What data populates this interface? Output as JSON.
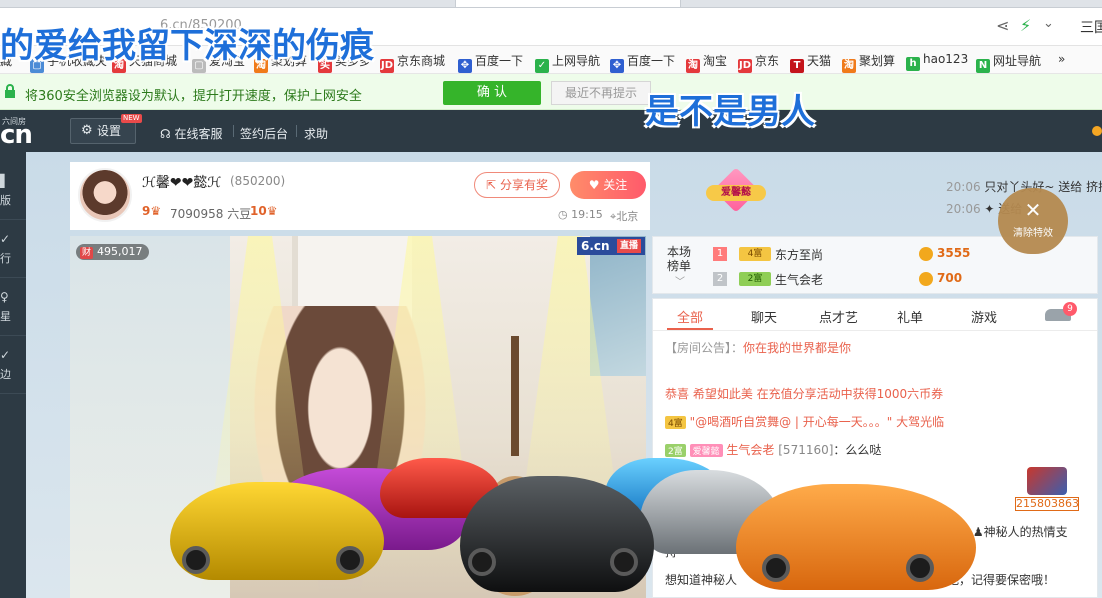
{
  "browser": {
    "url_hint": "6.cn/850200",
    "menu_label": "三国"
  },
  "bookmarks": [
    {
      "label": "藏",
      "icon": "star-icon",
      "color": "#888888"
    },
    {
      "label": "手机收藏夹",
      "icon": "doc-icon",
      "color": "#4b8bd6"
    },
    {
      "label": "天猫商城",
      "icon": "taobao-icon",
      "color": "#e4393c"
    },
    {
      "label": "爱淘宝",
      "icon": "doc-icon",
      "color": "#888888"
    },
    {
      "label": "聚划算",
      "icon": "taobao-icon",
      "color": "#f07a1a"
    },
    {
      "label": "美多多",
      "icon": "buy-icon",
      "color": "#e4393c"
    },
    {
      "label": "京东商城",
      "icon": "jd-icon",
      "color": "#e4393c"
    },
    {
      "label": "百度一下",
      "icon": "baidu-icon",
      "color": "#2f5fd0"
    },
    {
      "label": "上网导航",
      "icon": "hao-icon",
      "color": "#2bb24c"
    },
    {
      "label": "百度一下",
      "icon": "baidu-icon",
      "color": "#2f5fd0"
    },
    {
      "label": "淘宝",
      "icon": "taobao-icon",
      "color": "#e4393c"
    },
    {
      "label": "京东",
      "icon": "jd-icon",
      "color": "#e4393c"
    },
    {
      "label": "天猫",
      "icon": "tmall-icon",
      "color": "#c4141b"
    },
    {
      "label": "聚划算",
      "icon": "taobao-icon",
      "color": "#f07a1a"
    },
    {
      "label": "hao123",
      "icon": "hao123-icon",
      "color": "#2bb24c"
    },
    {
      "label": "网址导航",
      "icon": "nav-icon",
      "color": "#2bb24c"
    },
    {
      "label": "»",
      "icon": "",
      "color": "#666666"
    }
  ],
  "notify": {
    "message": "将360安全浏览器设为默认，提升打开速度，保护上网安全",
    "confirm": "确 认",
    "dismiss": "最近不再提示"
  },
  "nav": {
    "logo_small": "六间房",
    "logo_big": "cn",
    "settings": "设置",
    "new_badge": "NEW",
    "service": "在线客服",
    "backend": "签约后台",
    "help": "求助"
  },
  "sidebar": [
    {
      "icon": "▌",
      "label": "版"
    },
    {
      "icon": "✓",
      "label": "行"
    },
    {
      "icon": "♀",
      "label": "星"
    },
    {
      "icon": "✓",
      "label": "边"
    }
  ],
  "host": {
    "name": "ℋ馨❤❤懿ℋ",
    "room_id": "(850200)",
    "wealth_level": "9",
    "beans": "7090958 六豆",
    "star_level": "10",
    "share": "分享有奖",
    "follow": "关注",
    "time": "19:15",
    "city": "北京"
  },
  "fan_badge": "爱馨懿",
  "ticker": [
    {
      "time": "20:06",
      "text": "只对丫头好~ 送给 挤挤"
    },
    {
      "time": "20:06",
      "text": "✦ 送给 し"
    }
  ],
  "clear_effects": "清除特效",
  "video": {
    "viewer_tag": "财",
    "viewers": "495,017",
    "brand": "6.cn",
    "live": "直播"
  },
  "rank": {
    "label": "本场 榜单",
    "rows": [
      {
        "num": "1",
        "badge": "4富",
        "name": "东方至尚",
        "value": "3555"
      },
      {
        "num": "2",
        "badge": "2富",
        "name": "生气会老",
        "value": "700"
      }
    ]
  },
  "chat": {
    "tabs": [
      "全部",
      "聊天",
      "点才艺",
      "礼单",
      "游戏"
    ],
    "car_count": "9",
    "announce_label": "【房间公告】：",
    "announce_text": "你在我的世界都是你",
    "event": "恭喜 希望如此美 在充值分享活动中获得1000六币券",
    "msg1_badge": "4富",
    "msg1_text": "\"@喝酒听自赏舞@ | 开心每一天。。。\" 大驾光临",
    "msg2_badge": "2富",
    "msg2_fan": "爱馨懿",
    "msg2_name": "生气会老",
    "msg2_id": "[571160]",
    "msg2_text": "：么么哒",
    "gift_count": "215803863",
    "thanks": "感谢",
    "thanks_who": "神秘人的热情支",
    "partial1": "持",
    "footer": "想知道神秘人",
    "footer2": "查看吧，记得要保密哦！"
  },
  "overlay": {
    "lyric1": "的爱给我留下深深的伤痕",
    "lyric2": "是不是男人"
  }
}
